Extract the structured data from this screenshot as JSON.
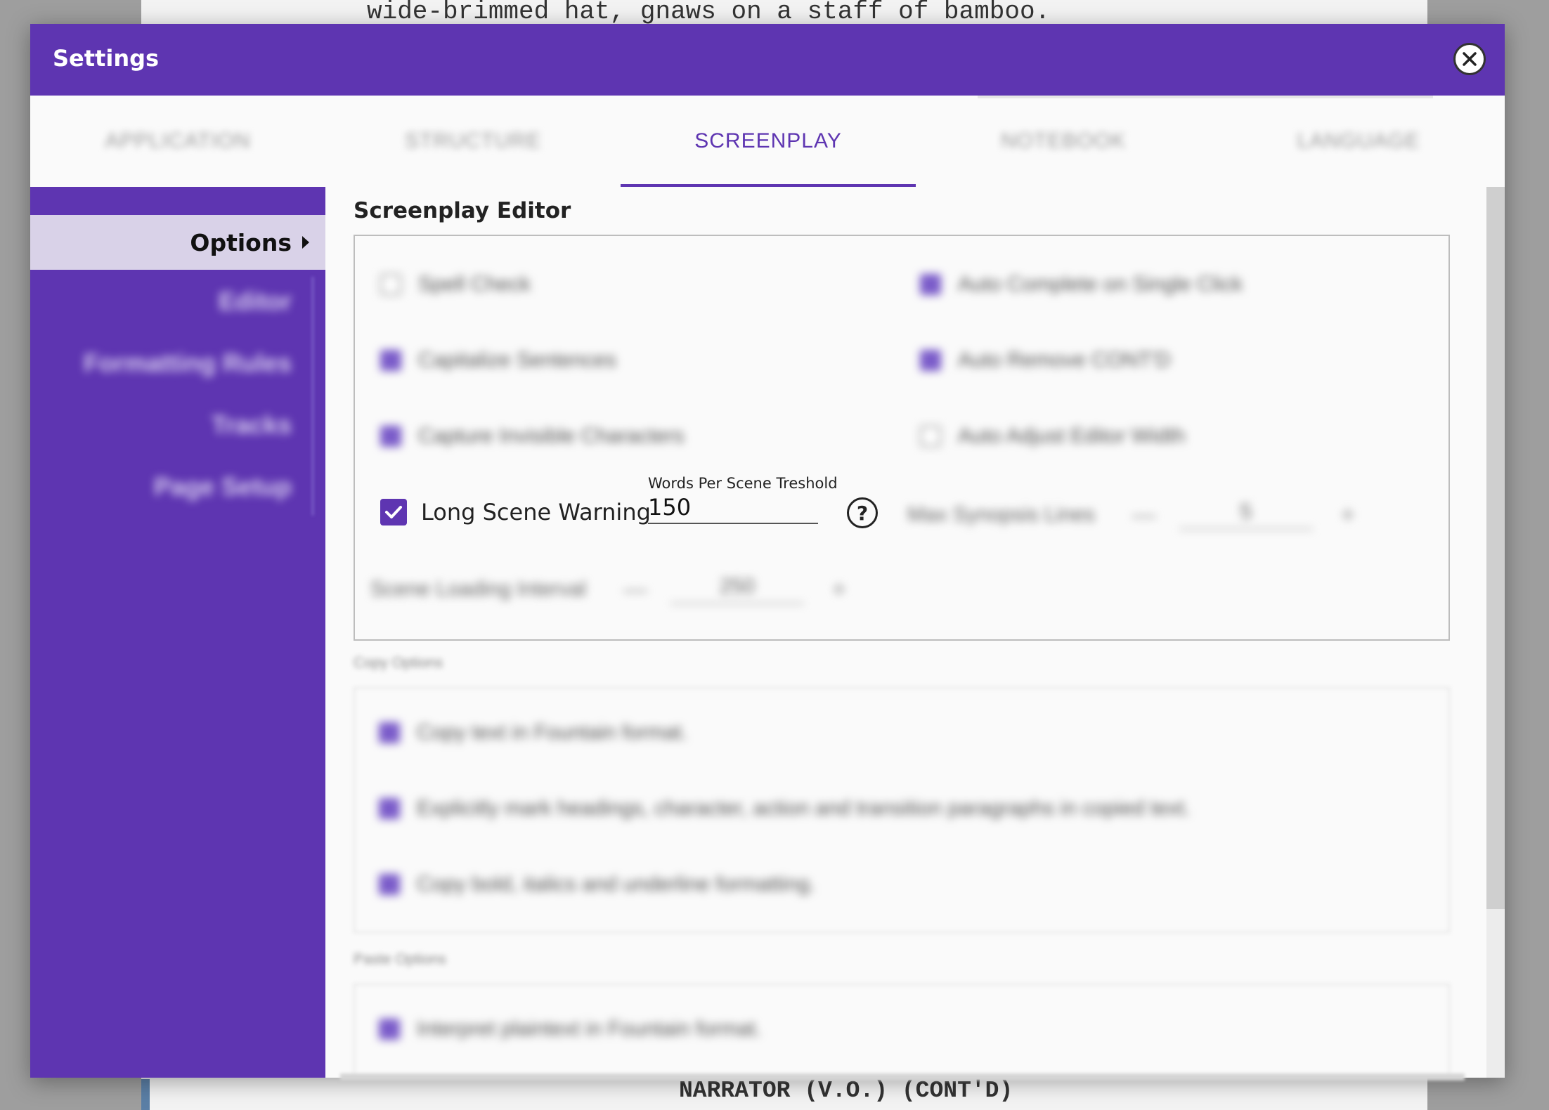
{
  "background_doc": {
    "top_line": "wide-brimmed hat, gnaws on a staff of bamboo.",
    "bottom_line": "NARRATOR (V.O.) (CONT'D)"
  },
  "dialog": {
    "title": "Settings",
    "close_icon": "close-icon"
  },
  "tabs": [
    {
      "label": "APPLICATION",
      "active": false
    },
    {
      "label": "STRUCTURE",
      "active": false
    },
    {
      "label": "SCREENPLAY",
      "active": true
    },
    {
      "label": "NOTEBOOK",
      "active": false
    },
    {
      "label": "LANGUAGE",
      "active": false
    }
  ],
  "sidebar": {
    "active_item": "Options",
    "active_icon": "caret-right-icon",
    "sub_items": [
      "Editor",
      "Formatting Rules",
      "Tracks",
      "Page Setup"
    ]
  },
  "editor_section": {
    "title": "Screenplay Editor",
    "options": [
      {
        "label": "Spell Check",
        "checked": false
      },
      {
        "label": "Auto Complete on Single Click",
        "checked": true
      },
      {
        "label": "Capitalize Sentences",
        "checked": true
      },
      {
        "label": "Auto Remove CONT'D",
        "checked": true
      },
      {
        "label": "Capture Invisible Characters",
        "checked": true
      },
      {
        "label": "Auto Adjust Editor Width",
        "checked": false
      }
    ],
    "long_scene_warning": {
      "label": "Long Scene Warning",
      "checked": true,
      "field_label": "Words Per Scene Treshold",
      "field_value": "150",
      "help_icon": "?"
    },
    "max_synopsis": {
      "label": "Max Synopsis Lines",
      "minus": "—",
      "value": "5",
      "plus": "+"
    },
    "scene_loading": {
      "label": "Scene Loading Interval",
      "minus": "—",
      "value": "250",
      "plus": "+"
    }
  },
  "copy_section": {
    "title": "Copy Options",
    "options": [
      {
        "label": "Copy text in Fountain format.",
        "checked": true
      },
      {
        "label": "Explicitly mark headings, character, action and transition paragraphs in copied text.",
        "checked": true
      },
      {
        "label": "Copy bold, italics and underline formatting.",
        "checked": true
      }
    ]
  },
  "paste_section": {
    "title": "Paste Options",
    "options": [
      {
        "label": "Interpret plaintext in Fountain format.",
        "checked": true
      }
    ]
  },
  "colors": {
    "accent": "#5e35b1",
    "sidebar_active_bg": "#d9d2e8"
  }
}
